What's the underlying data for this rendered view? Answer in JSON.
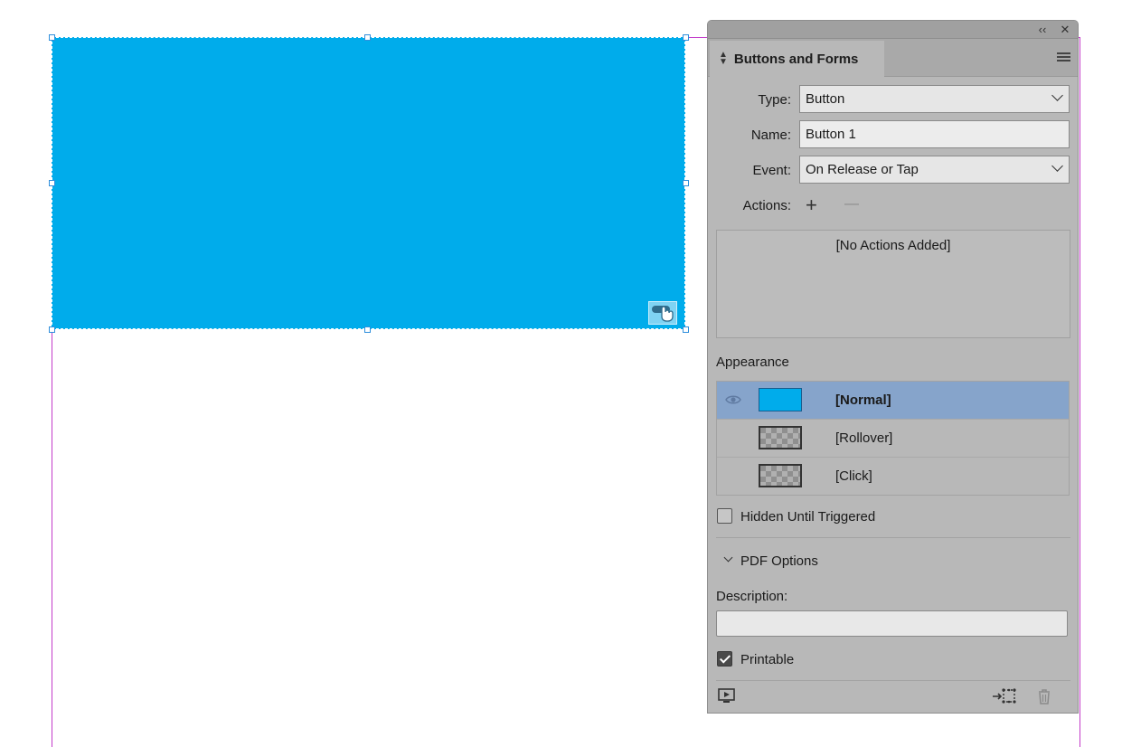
{
  "canvas": {
    "guide_color": "#c23ac9",
    "button_fill": "#00aceb",
    "button_badge_icon": "hand-pointer-icon"
  },
  "panel": {
    "topbar": {
      "collapse_icon": "double-chevron-left-icon",
      "collapse_label": "‹‹",
      "close_icon": "close-icon",
      "close_label": "✕"
    },
    "tab_title": "Buttons and Forms",
    "menu_icon": "panel-menu-icon",
    "fields": {
      "type_label": "Type:",
      "type_value": "Button",
      "name_label": "Name:",
      "name_value": "Button 1",
      "event_label": "Event:",
      "event_value": "On Release or Tap",
      "actions_label": "Actions:",
      "add_action": "+",
      "remove_action": "—"
    },
    "actions_empty": "[No Actions Added]",
    "appearance_label": "Appearance",
    "appearance_states": [
      {
        "name": "[Normal]",
        "selected": true,
        "thumb": "fill"
      },
      {
        "name": "[Rollover]",
        "selected": false,
        "thumb": "checker"
      },
      {
        "name": "[Click]",
        "selected": false,
        "thumb": "checker"
      }
    ],
    "hidden_until_triggered": {
      "label": "Hidden Until Triggered",
      "checked": false
    },
    "pdf_options_label": "PDF Options",
    "description_label": "Description:",
    "description_value": "",
    "printable": {
      "label": "Printable",
      "checked": true
    },
    "footer": {
      "preview_icon": "preview-spread-icon",
      "convert_icon": "convert-object-to-button-icon",
      "delete_icon": "trash-icon"
    },
    "colors": {
      "panel_bg": "#b8b8b8",
      "selection": "#86a4cb"
    }
  }
}
